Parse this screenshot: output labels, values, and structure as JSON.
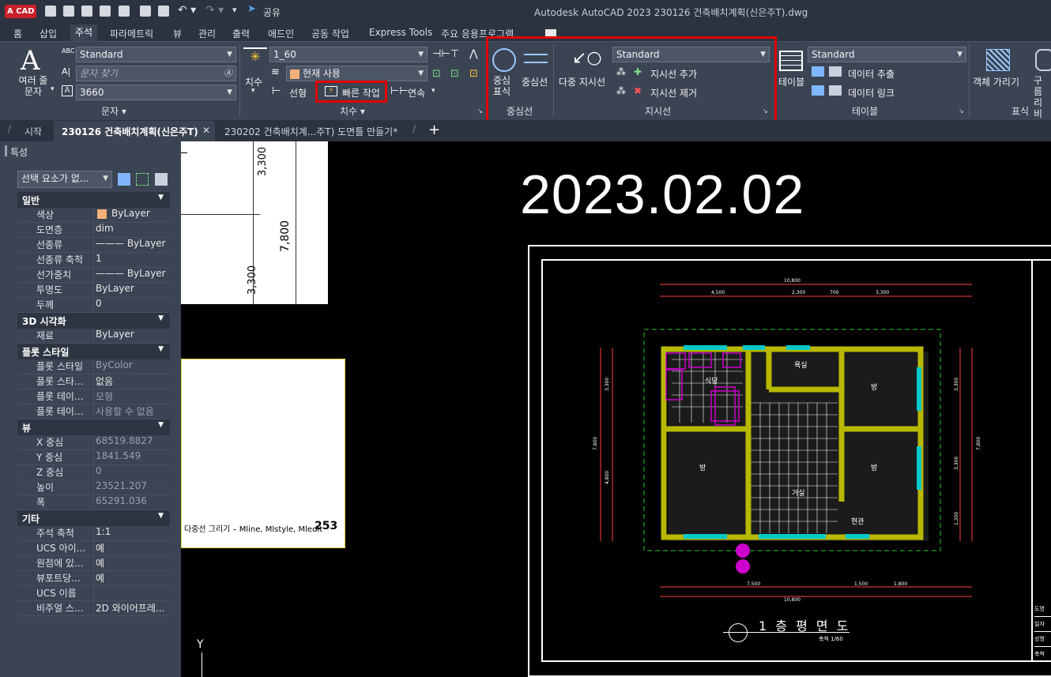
{
  "app": {
    "logo": "A CAD",
    "share": "공유",
    "window_title": "Autodesk AutoCAD 2023    230126 건축배치계획(신은주T).dwg"
  },
  "ribbon_tabs": [
    "홈",
    "삽입",
    "주석",
    "파라메트릭",
    "뷰",
    "관리",
    "출력",
    "애드인",
    "공동 작업",
    "Express Tools",
    "주요 응용프로그램"
  ],
  "ribbon": {
    "text": {
      "multiline_label": "여러 줄\n문자",
      "style_value": "Standard",
      "find_placeholder": "문자 찾기",
      "height_value": "3660",
      "panel": "문자 ▾"
    },
    "dim": {
      "label": "치수",
      "style_value": "1_60",
      "layer_value": "현재 사용",
      "linear": "선형",
      "quick": "빠른 작업",
      "continue": "연속",
      "panel": "치수 ▾"
    },
    "centerline": {
      "center_mark": "중심\n표식",
      "centerline": "중심선",
      "panel": "중심선"
    },
    "leader": {
      "multileader": "다중 지시선",
      "style_value": "Standard",
      "add": "지시선 추가",
      "remove": "지시선 제거",
      "panel": "지시선"
    },
    "table": {
      "label": "테이블",
      "style_value": "Standard",
      "extract": "데이터 추출",
      "link": "데이터 링크",
      "panel": "테이블"
    },
    "markup": {
      "wipeout": "객체 가리기",
      "cloud": "구름\n리비",
      "panel": "표식"
    }
  },
  "doc_tabs": {
    "start": "시작",
    "active": "230126 건축배치계획(신은주T)",
    "other": "230202 건축배치계...주T) 도면틀 만들기*",
    "new": "+"
  },
  "properties": {
    "title": "특성",
    "selection": "선택 요소가 없...",
    "sections": [
      {
        "name": "일반",
        "rows": [
          [
            "색상",
            "ByLayer"
          ],
          [
            "도면층",
            "dim"
          ],
          [
            "선종류",
            "——— ByLayer"
          ],
          [
            "선종류 축척",
            "1"
          ],
          [
            "선가중치",
            "——— ByLayer"
          ],
          [
            "투명도",
            "ByLayer"
          ],
          [
            "두께",
            "0"
          ]
        ]
      },
      {
        "name": "3D 시각화",
        "rows": [
          [
            "재료",
            "ByLayer"
          ]
        ]
      },
      {
        "name": "플롯 스타일",
        "rows": [
          [
            "플롯 스타일",
            "ByColor"
          ],
          [
            "플롯 스타...",
            "없음"
          ],
          [
            "플롯 테이...",
            "모형"
          ],
          [
            "플롯 테이...",
            "사용할 수 없음"
          ]
        ]
      },
      {
        "name": "뷰",
        "rows": [
          [
            "X 중심",
            "68519.8827"
          ],
          [
            "Y 중심",
            "1841.549"
          ],
          [
            "Z 중심",
            "0"
          ],
          [
            "높이",
            "23521.207"
          ],
          [
            "폭",
            "65291.036"
          ]
        ]
      },
      {
        "name": "기타",
        "rows": [
          [
            "주석 축척",
            "1:1"
          ],
          [
            "UCS 아이...",
            "예"
          ],
          [
            "원점에 있...",
            "예"
          ],
          [
            "뷰포트당...",
            "예"
          ],
          [
            "UCS 이름",
            ""
          ],
          [
            "비주얼 스...",
            "2D 와이어프레..."
          ]
        ]
      }
    ]
  },
  "canvas": {
    "date": "2023.02.02",
    "book_caption": "다중선 그리기 – Mline, Mlstyle, Mledit",
    "book_page": "253",
    "book_dims": [
      "3,300",
      "7,800",
      "3,300"
    ],
    "plan_title": "1 층 평 면 도",
    "plan_scale": "축척 1/60",
    "dims_top": [
      "10,800",
      "4,500",
      "2,300",
      "700",
      "3,300"
    ],
    "dims_bottom": [
      "7,500",
      "1,500",
      "1,800",
      "10,800"
    ],
    "dims_left": [
      "3,300",
      "4,800",
      "7,800"
    ],
    "dims_right": [
      "3,300",
      "3,300",
      "1,200",
      "7,800"
    ],
    "rooms": [
      "욕실",
      "식당",
      "방",
      "방",
      "방",
      "거실",
      "현관"
    ],
    "title_block": [
      "도명",
      "일자",
      "성명",
      "축척"
    ],
    "y_axis": "Y"
  }
}
